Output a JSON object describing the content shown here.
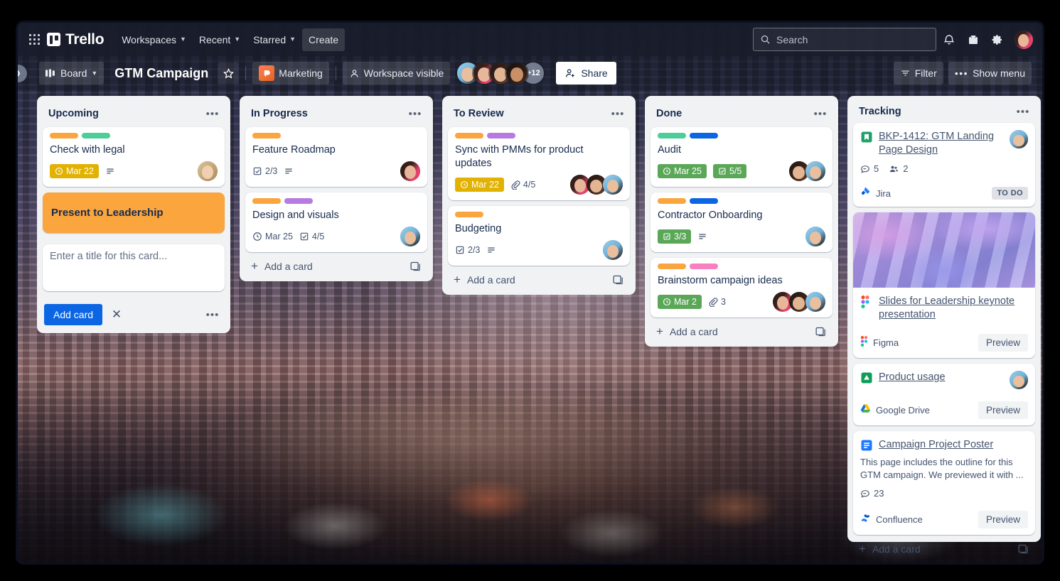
{
  "top_nav": {
    "apps_icon": "apps-grid-icon",
    "brand": "Trello",
    "items": [
      {
        "label": "Workspaces",
        "caret": "⌄"
      },
      {
        "label": "Recent",
        "caret": "⌄"
      },
      {
        "label": "Starred",
        "caret": "⌄"
      }
    ],
    "create_label": "Create",
    "search": {
      "icon": "search-icon",
      "placeholder": "Search",
      "value": ""
    },
    "right_icons": [
      "notifications-bell-icon",
      "briefcase-icon",
      "gear-icon"
    ],
    "avatar": "user-avatar"
  },
  "board_header": {
    "collapse_icon": "chevron-right-icon",
    "view_label": "Board",
    "view_caret": "⌄",
    "title": "GTM Campaign",
    "star_icon": "star-icon",
    "workspace_label": "Marketing",
    "visibility_label": "Workspace visible",
    "members_overflow": "+12",
    "share_label": "Share",
    "filter_label": "Filter",
    "menu_label": "Show menu"
  },
  "colors": {
    "label_orange": "#faa53d",
    "label_green": "#4bce97",
    "label_purple": "#b77ae0",
    "label_blue": "#0c66e4",
    "label_pink": "#f87fc0",
    "badge_yellow": "#e2b203",
    "badge_green": "#5aa758",
    "primary_button": "#0c66e4",
    "list_background": "#f1f2f4"
  },
  "lists": [
    {
      "title": "Upcoming",
      "menu_icon": "list-actions-icon",
      "cards": [
        {
          "title": "Check with legal",
          "labels": [
            "#faa53d",
            "#4bce97"
          ],
          "badges": [
            {
              "type": "due-yellow",
              "icon": "clock-icon",
              "text": "Mar 22"
            },
            {
              "type": "description",
              "icon": "description-icon",
              "text": ""
            }
          ],
          "members": [
            "member-blonde"
          ]
        }
      ],
      "composer": {
        "pending_card_title": "Present to Leadership",
        "pending_card_color": "#faa53d",
        "input_placeholder": "Enter a title for this card...",
        "input_value": "",
        "add_label": "Add card",
        "close_icon": "close-icon",
        "more_icon": "composer-options-icon"
      }
    },
    {
      "title": "In Progress",
      "menu_icon": "list-actions-icon",
      "cards": [
        {
          "title": "Feature Roadmap",
          "labels": [
            "#faa53d"
          ],
          "badges": [
            {
              "type": "checklist",
              "icon": "checklist-icon",
              "text": "2/3"
            },
            {
              "type": "description",
              "icon": "description-icon",
              "text": ""
            }
          ],
          "members": [
            "member-pink"
          ]
        },
        {
          "title": "Design and visuals",
          "labels": [
            "#faa53d",
            "#b77ae0"
          ],
          "badges": [
            {
              "type": "due",
              "icon": "clock-icon",
              "text": "Mar 25"
            },
            {
              "type": "checklist",
              "icon": "checklist-icon",
              "text": "4/5"
            }
          ],
          "members": [
            "member-teal"
          ]
        }
      ],
      "add_card_label": "Add a card",
      "template_icon": "card-template-icon"
    },
    {
      "title": "To Review",
      "menu_icon": "list-actions-icon",
      "cards": [
        {
          "title": "Sync with PMMs for product updates",
          "labels": [
            "#faa53d",
            "#b77ae0"
          ],
          "badges": [
            {
              "type": "due-yellow",
              "icon": "clock-icon",
              "text": "Mar 22"
            },
            {
              "type": "attachment",
              "icon": "attachment-icon",
              "text": "4/5"
            }
          ],
          "members": [
            "member-pink",
            "member-brown",
            "member-teal"
          ]
        },
        {
          "title": "Budgeting",
          "labels": [
            "#faa53d"
          ],
          "badges": [
            {
              "type": "checklist",
              "icon": "checklist-icon",
              "text": "2/3"
            },
            {
              "type": "description",
              "icon": "description-icon",
              "text": ""
            }
          ],
          "members": [
            "member-teal"
          ]
        }
      ],
      "add_card_label": "Add a card",
      "template_icon": "card-template-icon"
    },
    {
      "title": "Done",
      "menu_icon": "list-actions-icon",
      "cards": [
        {
          "title": "Audit",
          "labels": [
            "#4bce97",
            "#0c66e4"
          ],
          "badges": [
            {
              "type": "due-green",
              "icon": "clock-icon",
              "text": "Mar 25"
            },
            {
              "type": "checklist-green",
              "icon": "checklist-icon",
              "text": "5/5"
            }
          ],
          "members": [
            "member-brown",
            "member-teal"
          ]
        },
        {
          "title": "Contractor Onboarding",
          "labels": [
            "#faa53d",
            "#0c66e4"
          ],
          "badges": [
            {
              "type": "checklist-green",
              "icon": "checklist-icon",
              "text": "3/3"
            },
            {
              "type": "description",
              "icon": "description-icon",
              "text": ""
            }
          ],
          "members": [
            "member-teal"
          ]
        },
        {
          "title": "Brainstorm campaign ideas",
          "labels": [
            "#faa53d",
            "#f87fc0"
          ],
          "badges": [
            {
              "type": "due-green",
              "icon": "clock-icon",
              "text": "Mar 2"
            },
            {
              "type": "attachment",
              "icon": "attachment-icon",
              "text": "3"
            }
          ],
          "members": [
            "member-pink",
            "member-brown",
            "member-teal"
          ]
        }
      ],
      "add_card_label": "Add a card",
      "template_icon": "card-template-icon"
    },
    {
      "title": "Tracking",
      "menu_icon": "list-actions-icon",
      "smart_cards": [
        {
          "icon": "jira-issue-icon",
          "title": "BKP-1412: GTM Landing Page Design",
          "avatar": "member-teal",
          "stats": [
            {
              "icon": "comment-icon",
              "text": "5"
            },
            {
              "icon": "people-icon",
              "text": "2"
            }
          ],
          "provider_icon": "jira-icon",
          "provider": "Jira",
          "status_chip": "TO DO"
        },
        {
          "cover": "figma-3d-shapes-cover",
          "icon": "figma-icon",
          "title": "Slides for Leadership keynote presentation",
          "provider_icon": "figma-icon",
          "provider": "Figma",
          "preview_label": "Preview"
        },
        {
          "icon": "google-drive-doc-icon",
          "title": "Product usage",
          "avatar": "member-teal",
          "provider_icon": "google-drive-icon",
          "provider": "Google Drive",
          "preview_label": "Preview"
        },
        {
          "icon": "confluence-page-icon",
          "title": "Campaign Project Poster",
          "description": "This page includes the outline for this GTM campaign. We previewed it with ...",
          "stats": [
            {
              "icon": "comment-icon",
              "text": "23"
            }
          ],
          "provider_icon": "confluence-icon",
          "provider": "Confluence",
          "preview_label": "Preview"
        }
      ],
      "add_card_label": "Add a card",
      "template_icon": "card-template-icon"
    }
  ]
}
